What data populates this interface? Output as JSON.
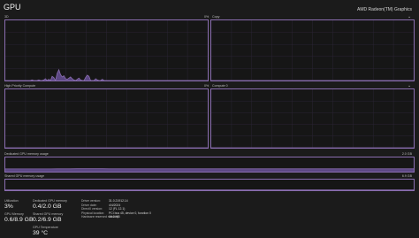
{
  "header": {
    "title": "GPU",
    "gpu_name": "AMD Radeon(TM) Graphics"
  },
  "engines": {
    "top_left": {
      "label": "3D",
      "percent": ""
    },
    "top_right": {
      "label": "Copy",
      "percent": "0%"
    },
    "mid_left": {
      "label": "High Priority Compute",
      "percent": ""
    },
    "mid_right": {
      "label": "Compute 0",
      "percent": "0%"
    }
  },
  "memory": {
    "dedicated_label": "Dedicated GPU memory usage",
    "dedicated_max": "2.0 GB",
    "shared_label": "Shared GPU memory usage",
    "shared_max": "6.9 GB"
  },
  "stats": {
    "utilization": {
      "label": "Utilization",
      "value": "3%"
    },
    "dedicated": {
      "label": "Dedicated GPU memory",
      "value": "0.4/2.0 GB"
    },
    "gpu_memory": {
      "label": "GPU Memory",
      "value": "0.6/8.9 GB"
    },
    "shared": {
      "label": "Shared GPU memory",
      "value": "0.2/6.9 GB"
    },
    "temperature": {
      "label": "GPU Temperature",
      "value": "39 °C"
    }
  },
  "details": [
    {
      "key": "Driver version:",
      "value": "31.0.21912.14"
    },
    {
      "key": "Driver date:",
      "value": "4/4/2024"
    },
    {
      "key": "DirectX version:",
      "value": "12 (FL 12.1)"
    },
    {
      "key": "Physical location:",
      "value": "PCI bus 45, device 0, function 0"
    },
    {
      "key": "Hardware reserved memory:",
      "value": "16.2 MB"
    }
  ],
  "chart_data": [
    {
      "type": "area",
      "title": "3D",
      "ylim": [
        0,
        100
      ],
      "values": [
        0,
        0,
        0,
        0,
        0,
        0,
        0,
        0,
        0,
        0,
        0,
        0,
        0,
        0,
        0,
        0,
        1,
        0,
        0,
        0,
        1,
        0,
        0,
        1,
        3,
        0,
        2,
        0,
        7,
        5,
        0,
        12,
        18,
        10,
        6,
        8,
        3,
        2,
        4,
        6,
        3,
        1,
        0,
        2,
        4,
        1,
        0,
        0,
        5,
        9,
        7,
        0,
        0,
        0,
        3,
        1,
        0,
        0,
        2,
        0,
        0,
        0,
        0,
        0,
        0,
        0,
        0,
        0,
        0,
        0,
        0,
        0,
        0,
        0,
        0,
        0,
        0,
        0,
        0,
        0,
        0,
        0,
        0,
        0,
        0,
        0,
        0,
        0,
        0,
        0,
        0,
        0,
        0,
        0,
        0,
        0,
        0,
        0,
        0,
        0,
        0,
        0,
        0,
        0,
        0,
        0,
        0,
        0,
        0,
        0,
        0,
        0,
        0,
        0,
        0,
        0,
        0,
        0,
        0,
        0,
        0,
        0
      ]
    },
    {
      "type": "area",
      "title": "Copy",
      "ylim": [
        0,
        100
      ],
      "values": [
        0,
        0,
        0,
        0,
        0,
        0,
        0,
        0,
        0,
        0,
        0,
        0,
        0,
        0,
        0,
        0,
        0,
        0,
        0,
        0,
        0,
        0,
        0,
        0,
        0,
        0,
        0,
        0,
        0,
        0,
        0,
        0,
        0,
        0,
        0,
        0,
        0,
        0,
        0,
        0,
        0,
        0,
        0,
        0,
        0,
        0,
        0,
        0,
        0,
        0,
        0,
        0,
        0,
        0,
        0,
        0,
        0,
        0,
        0,
        0,
        0,
        0,
        0
      ]
    },
    {
      "type": "area",
      "title": "High Priority Compute",
      "ylim": [
        0,
        100
      ],
      "values": [
        0,
        0,
        0,
        0,
        0,
        0,
        0,
        0,
        0,
        0,
        0,
        0,
        0,
        0,
        0,
        0,
        0,
        0,
        0,
        0,
        0,
        0,
        0,
        0,
        0,
        0,
        0,
        0,
        0,
        0,
        0,
        0,
        0,
        0,
        0,
        0,
        0,
        0,
        0,
        0,
        0,
        0,
        0,
        0,
        0,
        0,
        0,
        0,
        0,
        0,
        0,
        0,
        0,
        0,
        0,
        0,
        0,
        0,
        0,
        0,
        0,
        0,
        0
      ]
    },
    {
      "type": "area",
      "title": "Compute 0",
      "ylim": [
        0,
        100
      ],
      "values": [
        0,
        0,
        0,
        0,
        0,
        0,
        0,
        0,
        0,
        0,
        0,
        0,
        0,
        0,
        0,
        0,
        0,
        0,
        0,
        0,
        0,
        0,
        0,
        0,
        0,
        0,
        0,
        0,
        0,
        0,
        0,
        0,
        0,
        0,
        0,
        0,
        0,
        0,
        0,
        0,
        0,
        0,
        0,
        0,
        0,
        0,
        0,
        0,
        0,
        0,
        0,
        0,
        0,
        0,
        0,
        0,
        0,
        0,
        0,
        0,
        0,
        0,
        0
      ]
    },
    {
      "type": "area",
      "title": "Dedicated GPU memory usage",
      "ylim": [
        0,
        2.0
      ],
      "values": [
        0.4,
        0.4,
        0.4,
        0.4,
        0.4,
        0.4,
        0.4,
        0.4,
        0.41,
        0.41,
        0.41,
        0.42,
        0.42,
        0.42,
        0.42,
        0.42,
        0.41,
        0.41,
        0.41,
        0.41,
        0.41,
        0.41,
        0.41,
        0.41,
        0.41,
        0.41,
        0.41,
        0.41,
        0.41,
        0.41,
        0.41,
        0.41,
        0.41,
        0.41,
        0.41,
        0.41,
        0.41,
        0.41,
        0.41,
        0.41,
        0.41,
        0.41,
        0.41,
        0.41,
        0.41,
        0.41,
        0.41,
        0.41,
        0.41,
        0.41,
        0.41,
        0.41,
        0.41,
        0.41,
        0.41,
        0.41,
        0.41,
        0.41,
        0.41,
        0.41,
        0.41,
        0.41,
        0.41,
        0.41
      ]
    },
    {
      "type": "line",
      "title": "Shared GPU memory usage",
      "ylim": [
        0,
        6.9
      ],
      "values": [
        0.2,
        0.2,
        0.2,
        0.2,
        0.2,
        0.2,
        0.2,
        0.2,
        0.2,
        0.2,
        0.2,
        0.2,
        0.2,
        0.2,
        0.2,
        0.2,
        0.2,
        0.2,
        0.2,
        0.2,
        0.2,
        0.2,
        0.2,
        0.2,
        0.2,
        0.2,
        0.2,
        0.2,
        0.2,
        0.2,
        0.2,
        0.2,
        0.2,
        0.2,
        0.2,
        0.2,
        0.2,
        0.2,
        0.2,
        0.2,
        0.2,
        0.2,
        0.2,
        0.2,
        0.2,
        0.2,
        0.2,
        0.2,
        0.2,
        0.2,
        0.2,
        0.2,
        0.2,
        0.2,
        0.2,
        0.2,
        0.2,
        0.2,
        0.2,
        0.2,
        0.2,
        0.2,
        0.2,
        0.2
      ]
    }
  ],
  "colors": {
    "accent": "#8a6db0",
    "fill": "#6e55a0",
    "background": "#1b1b1b"
  }
}
